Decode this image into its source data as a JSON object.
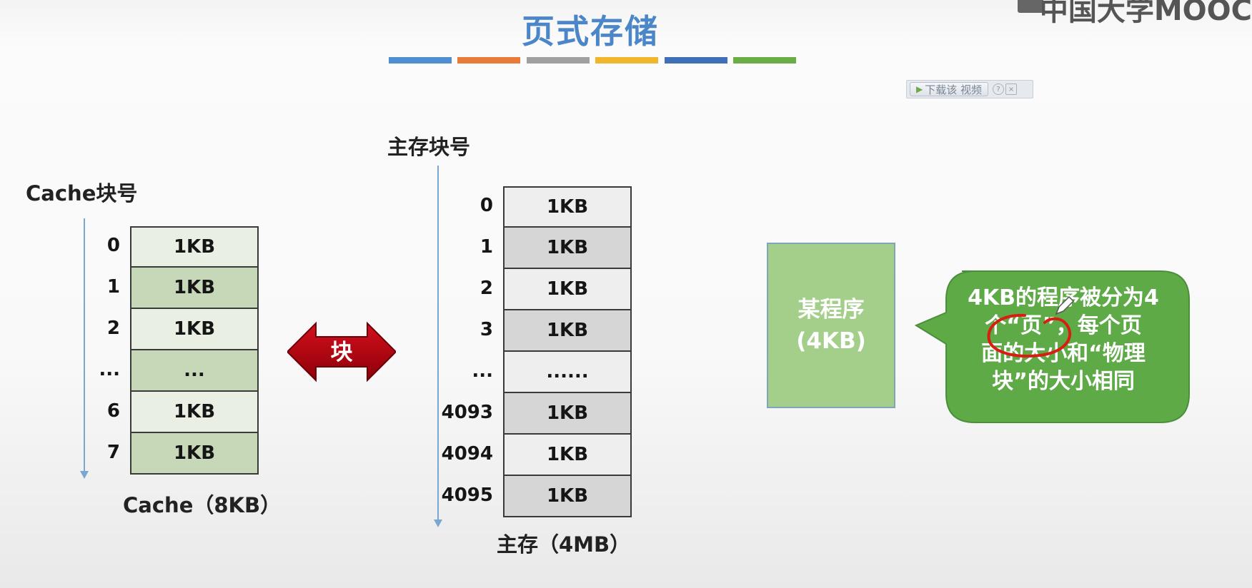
{
  "title": "页式存储",
  "logo_text": "中国大学MOOC",
  "stripe_colors": [
    "#4f8fcf",
    "#e87b3a",
    "#a0a0a0",
    "#f0b72c",
    "#3e6fb7",
    "#6aac45"
  ],
  "download_toolbar": {
    "button_label": "下载该 视频",
    "help_label": "?",
    "close_label": "×"
  },
  "cache": {
    "heading": "Cache块号",
    "rows": [
      {
        "index": "0",
        "label": "1KB"
      },
      {
        "index": "1",
        "label": "1KB"
      },
      {
        "index": "2",
        "label": "1KB"
      },
      {
        "index": "...",
        "label": "..."
      },
      {
        "index": "6",
        "label": "1KB"
      },
      {
        "index": "7",
        "label": "1KB"
      }
    ],
    "caption": "Cache（8KB）"
  },
  "transfer_arrow_label": "块",
  "main_memory": {
    "heading": "主存块号",
    "rows": [
      {
        "index": "0",
        "label": "1KB"
      },
      {
        "index": "1",
        "label": "1KB"
      },
      {
        "index": "2",
        "label": "1KB"
      },
      {
        "index": "3",
        "label": "1KB"
      },
      {
        "index": "...",
        "label": "......"
      },
      {
        "index": "4093",
        "label": "1KB"
      },
      {
        "index": "4094",
        "label": "1KB"
      },
      {
        "index": "4095",
        "label": "1KB"
      }
    ],
    "caption": "主存（4MB）"
  },
  "program_box": {
    "line1": "某程序",
    "line2": "(4KB)"
  },
  "callout": {
    "line1": "4KB的程序被分为4",
    "line2": "个“页”，每个页",
    "line3": "面的大小和“物理",
    "line4": "块”的大小相同"
  },
  "colors": {
    "title": "#4a86c8",
    "cache_light": "#e9f0e3",
    "cache_dark": "#c7d8b8",
    "memory_light": "#eeeeee",
    "memory_dark": "#d6d6d6",
    "arrow_red": "#b3000e",
    "program_green": "#a3cf8a",
    "callout_green": "#5daa47",
    "annotation_red": "#d81e12"
  }
}
